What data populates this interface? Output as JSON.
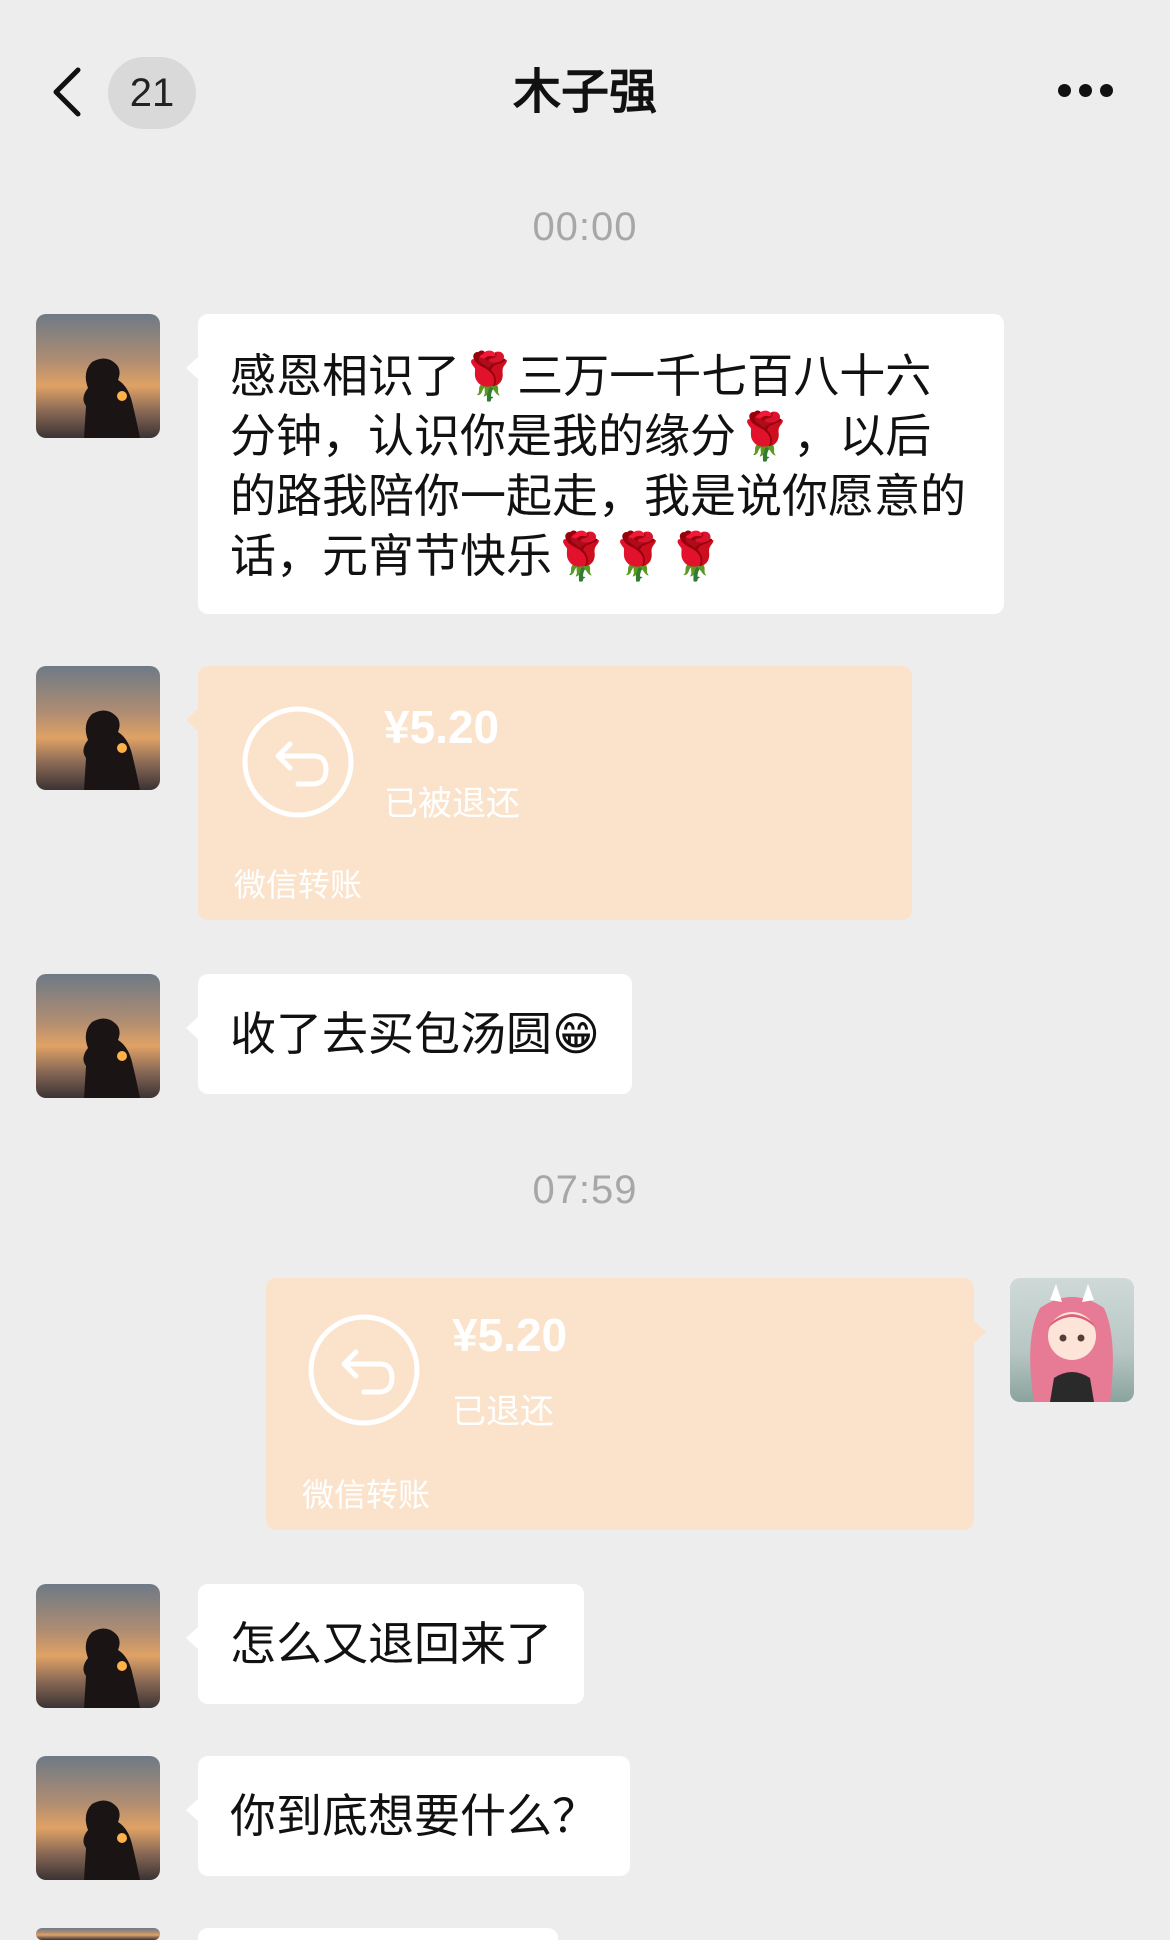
{
  "header": {
    "back_label": "back",
    "unread_count": "21",
    "title": "木子强",
    "more_label": "more"
  },
  "messages": {
    "time_1": "00:00",
    "msg_1": {
      "part_a": "感恩相识了",
      "part_b": "三万一千七百八十六分钟，认识你是我的缘分",
      "part_c": "，以后的路我陪你一起走，我是说你愿意的话，元宵节快乐",
      "emoji": "rose"
    },
    "transfer_1": {
      "amount": "¥5.20",
      "status": "已被退还",
      "footer": "微信转账"
    },
    "msg_2": {
      "text": "收了去买包汤圆",
      "emoji": "grinning-face"
    },
    "time_2": "07:59",
    "transfer_2": {
      "amount": "¥5.20",
      "status": "已退还",
      "footer": "微信转账"
    },
    "msg_3": "怎么又退回来了",
    "msg_4": "你到底想要什么？"
  },
  "colors": {
    "background": "#ededed",
    "bubble_incoming": "#ffffff",
    "transfer_card": "#fbe3cb",
    "timestamp": "#a7a7a7"
  }
}
